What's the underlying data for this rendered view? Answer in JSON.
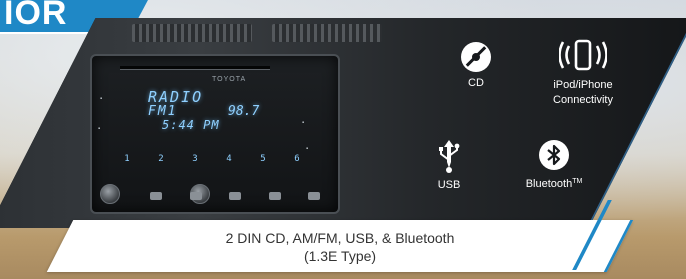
{
  "corner_tab": {
    "text": "IOR"
  },
  "stereo": {
    "brand": "TOYOTA",
    "lcd_line1": "RADIO",
    "lcd_line2": "FM1",
    "lcd_freq": "98.7",
    "lcd_line3": "5:44 PM",
    "presets": [
      "1",
      "2",
      "3",
      "4",
      "5",
      "6"
    ]
  },
  "features": [
    {
      "icon": "cd-disc-icon",
      "label": "CD"
    },
    {
      "icon": "iphone-connectivity-icon",
      "label_line1": "iPod/iPhone",
      "label_line2": "Connectivity"
    },
    {
      "icon": "usb-icon",
      "label": "USB"
    },
    {
      "icon": "bluetooth-icon",
      "label": "Bluetooth",
      "tm": "TM"
    }
  ],
  "caption": {
    "line1": "2 DIN CD, AM/FM, USB, & Bluetooth",
    "line2": "(1.3E Type)"
  },
  "colors": {
    "accent_blue": "#1f88c6",
    "panel_dark": "#16191c",
    "lcd_blue": "#8fd0ff",
    "caption_text": "#333333"
  }
}
